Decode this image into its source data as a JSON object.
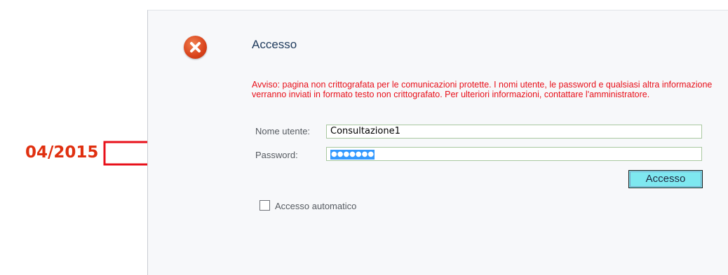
{
  "annotation": {
    "date_text": "04/2015",
    "color": "#e03010"
  },
  "dialog": {
    "title": "Accesso",
    "error_icon": "error-x-circle-icon",
    "warning": "Avviso: pagina non crittografata per le comunicazioni protette. I nomi utente, le password e qualsiasi altra informazione verranno inviati in formato testo non crittografato. Per ulteriori informazioni, contattare l'amministratore.",
    "warning_color": "#e8101a",
    "username": {
      "label": "Nome utente:",
      "value": "Consultazione1"
    },
    "password": {
      "label": "Password:",
      "masked_value": "●●●●●●●"
    },
    "submit_label": "Accesso",
    "auto_login": {
      "label": "Accesso automatico",
      "checked": false
    }
  }
}
